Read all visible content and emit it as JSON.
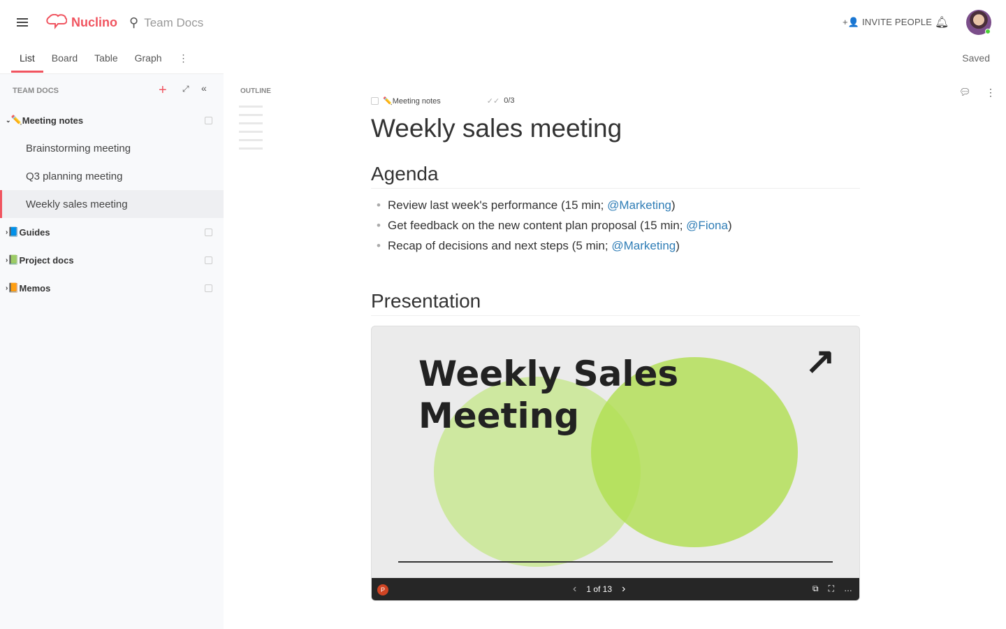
{
  "header": {
    "brand": "Nuclino",
    "workspace": "Team Docs",
    "invite_label": "INVITE PEOPLE",
    "status": "Saved"
  },
  "tabs": [
    {
      "label": "List",
      "active": true
    },
    {
      "label": "Board"
    },
    {
      "label": "Table"
    },
    {
      "label": "Graph"
    }
  ],
  "sidebar": {
    "title": "TEAM DOCS",
    "items": [
      {
        "label": "Meeting notes",
        "emoji": "✏️",
        "expanded": true
      },
      {
        "label": "Brainstorming meeting"
      },
      {
        "label": "Q3 planning meeting"
      },
      {
        "label": "Weekly sales meeting",
        "selected": true
      },
      {
        "label": "Guides",
        "emoji": "📘"
      },
      {
        "label": "Project docs",
        "emoji": "📗"
      },
      {
        "label": "Memos",
        "emoji": "📙"
      }
    ]
  },
  "outline": {
    "label": "OUTLINE"
  },
  "doc": {
    "breadcrumb": "✏️Meeting notes",
    "tasks": "0/3",
    "title": "Weekly sales meeting",
    "agenda_heading": "Agenda",
    "agenda": [
      {
        "text": "Review last week's performance (15 min; ",
        "mention": "@Marketing",
        "end": ")"
      },
      {
        "text": "Get feedback on the new content plan proposal (15 min; ",
        "mention": "@Fiona",
        "end": ")"
      },
      {
        "text": "Recap of decisions and next steps (5 min; ",
        "mention": "@Marketing",
        "end": ")"
      }
    ],
    "presentation_heading": "Presentation",
    "slide": {
      "title_line1": "Weekly Sales",
      "title_line2": "Meeting",
      "page": "1 of 13"
    }
  },
  "colors": {
    "accent": "#f0545f",
    "mention": "#2f7db6"
  }
}
